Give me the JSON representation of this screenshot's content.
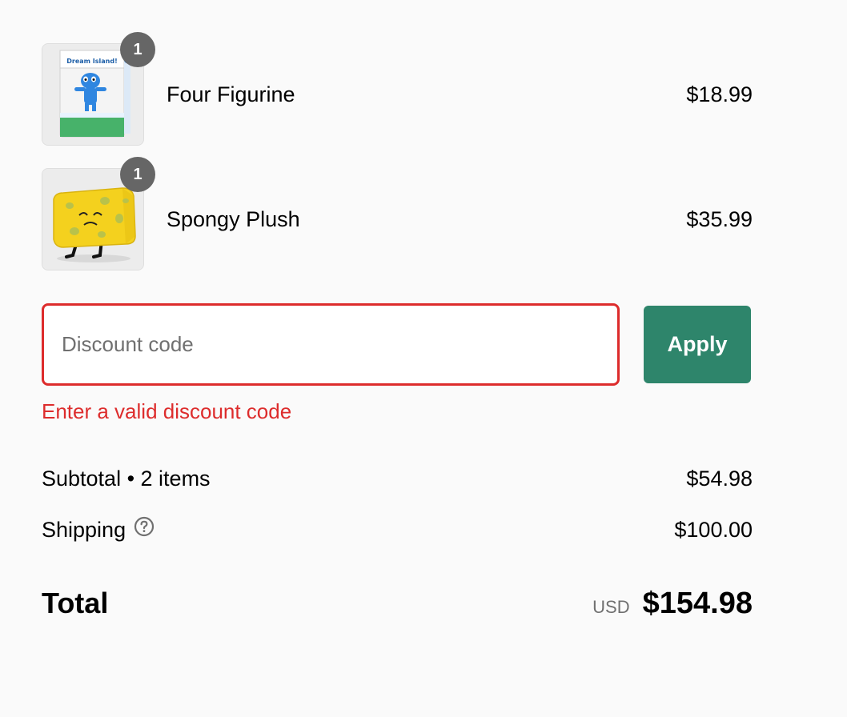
{
  "line_items": [
    {
      "name": "Four Figurine",
      "price": "$18.99",
      "quantity": "1",
      "thumbnail_icon": "figurine-box-image",
      "thumbnail_text": "Dream Island!"
    },
    {
      "name": "Spongy Plush",
      "price": "$35.99",
      "quantity": "1",
      "thumbnail_icon": "sponge-plush-image"
    }
  ],
  "discount": {
    "placeholder": "Discount code",
    "value": "",
    "apply_label": "Apply",
    "error": "Enter a valid discount code"
  },
  "summary": {
    "subtotal_label": "Subtotal • 2 items",
    "subtotal_value": "$54.98",
    "shipping_label": "Shipping",
    "shipping_value": "$100.00",
    "total_label": "Total",
    "currency": "USD",
    "total_value": "$154.98"
  },
  "colors": {
    "background": "#fafafa",
    "accent": "#2e856b",
    "error": "#dd2c2c",
    "badge": "#666666"
  }
}
